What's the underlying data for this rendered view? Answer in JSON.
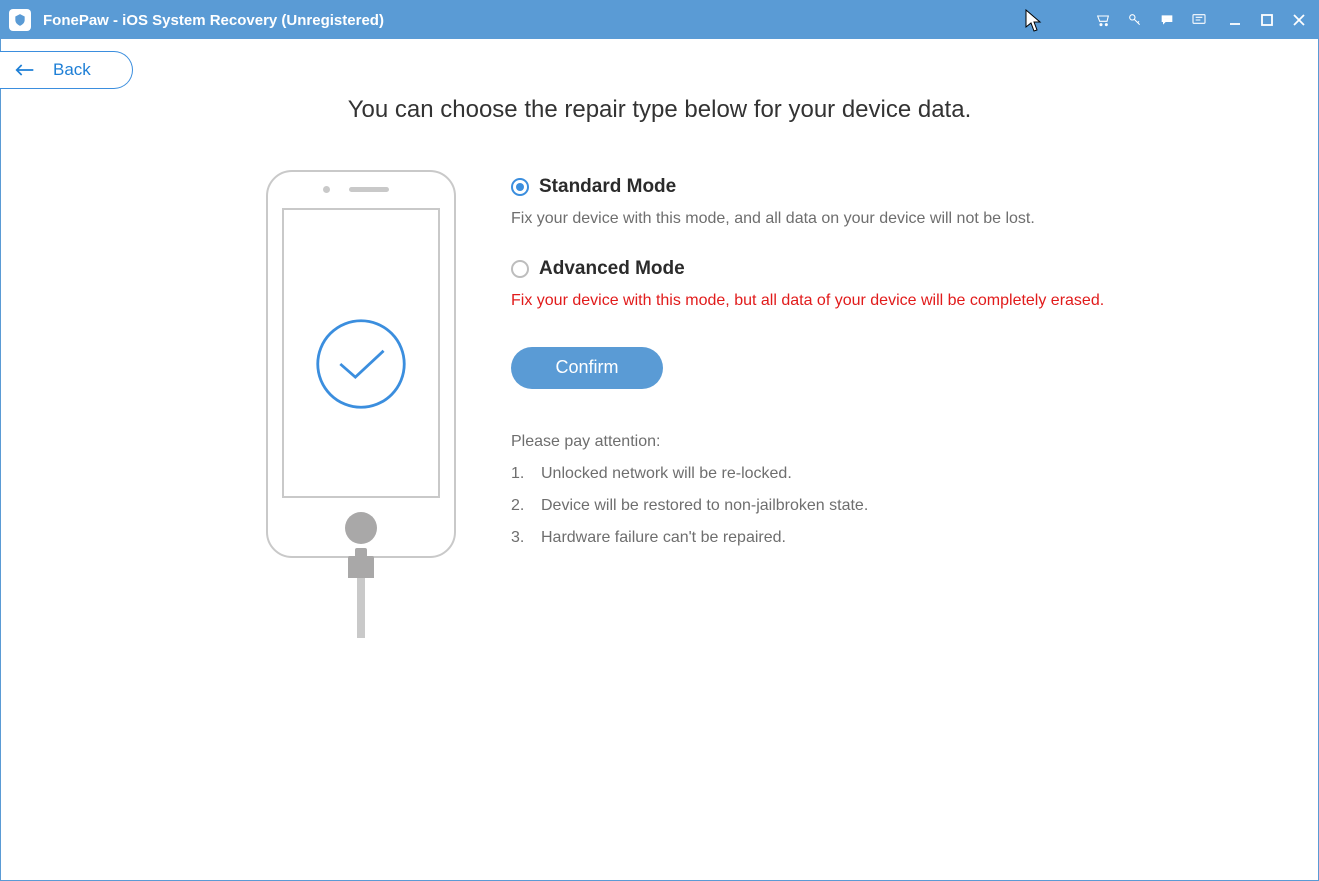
{
  "titlebar": {
    "title": "FonePaw - iOS System Recovery (Unregistered)"
  },
  "back_label": "Back",
  "heading": "You can choose the repair type below for your device data.",
  "modes": {
    "standard": {
      "label": "Standard Mode",
      "desc": "Fix your device with this mode, and all data on your device will not be lost.",
      "selected": true
    },
    "advanced": {
      "label": "Advanced Mode",
      "desc": "Fix your device with this mode, but all data of your device will be completely erased.",
      "selected": false
    }
  },
  "confirm_label": "Confirm",
  "attention": {
    "heading": "Please pay attention:",
    "items": [
      "Unlocked network will be re-locked.",
      "Device will be restored to non-jailbroken state.",
      "Hardware failure can't be repaired."
    ]
  }
}
